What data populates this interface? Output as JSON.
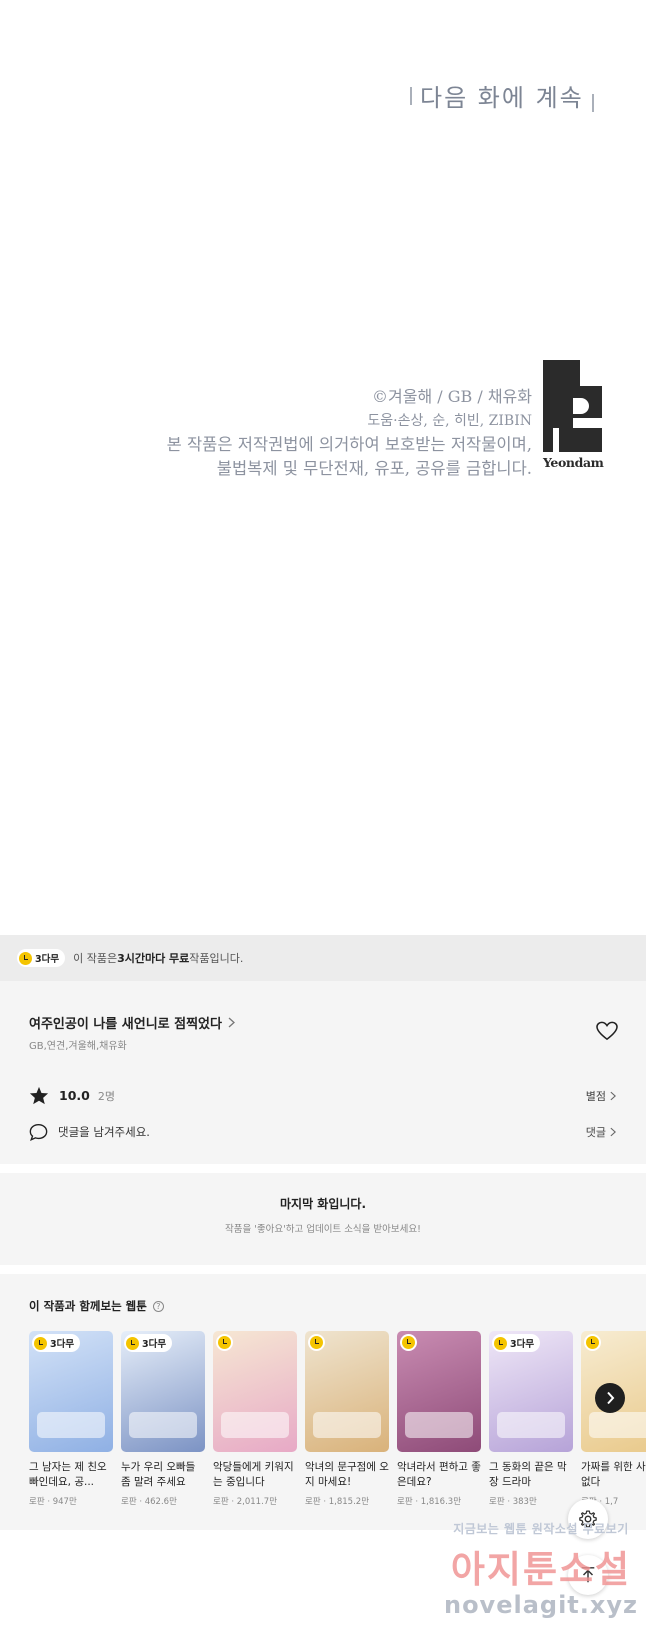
{
  "comic": {
    "next_notice": "다음 화에 계속",
    "copyright_line1": "©겨울해 / GB / 채유화",
    "copyright_line2": "도움·손상, 순, 히빈, ZIBIN",
    "copyright_line3": "본 작품은 저작권법에 의거하여 보호받는 저작물이며,",
    "copyright_line4": "불법복제 및 무단전재, 유포, 공유를 금합니다.",
    "publisher": "Yeondam"
  },
  "free_banner": {
    "badge": "3다무",
    "text_before": "이 작품은 ",
    "text_bold": "3시간마다 무료",
    "text_after": " 작품입니다."
  },
  "series": {
    "title": "여주인공이 나를 새언니로 점찍었다",
    "authors": "GB,연견,겨울해,채유화",
    "rating": "10.0",
    "rating_count": "2명",
    "rate_link": "별점",
    "comment_placeholder": "댓글을 남겨주세요.",
    "comment_link": "댓글"
  },
  "last_episode": {
    "title": "마지막 화입니다.",
    "subtitle": "작품을 '좋아요'하고 업데이트 소식을 받아보세요!"
  },
  "recommendations": {
    "title": "이 작품과 함께보는 웹툰",
    "items": [
      {
        "title": "그 남자는 제 친오빠인데요, 공...",
        "meta": "로판 · 947만",
        "badge": "3다무",
        "color": "#8fb0e4",
        "color2": "#d3e2f7"
      },
      {
        "title": "누가 우리 오빠들 좀 말려 주세요",
        "meta": "로판 · 462.6만",
        "badge": "3다무",
        "color": "#7c93c4",
        "color2": "#e6eef9"
      },
      {
        "title": "악당들에게 키워지는 중입니다",
        "meta": "로판 · 2,011.7만",
        "badge": "",
        "color": "#e7a9c6",
        "color2": "#f6e7d3"
      },
      {
        "title": "악녀의 문구점에 오지 마세요!",
        "meta": "로판 · 1,815.2만",
        "badge": "",
        "color": "#d9b27a",
        "color2": "#efe4cf"
      },
      {
        "title": "악녀라서 편하고 좋은데요?",
        "meta": "로판 · 1,816.3만",
        "badge": "",
        "color": "#8e4b78",
        "color2": "#c98cb2"
      },
      {
        "title": "그 동화의 끝은 막장 드라마",
        "meta": "로판 · 383만",
        "badge": "3다무",
        "color": "#b6a3d8",
        "color2": "#efe7f7"
      },
      {
        "title": "가짜를 위한 사랑은 없다",
        "meta": "로판 · 1,7",
        "badge": "",
        "color": "#e9c98a",
        "color2": "#f7ecd2"
      }
    ]
  },
  "watermark": {
    "line1": "지금보는 웹툰 원작소설 무료보기",
    "line2": "아지툰소설",
    "line3": "novelagit.xyz"
  },
  "icons": {
    "heart": "heart-icon",
    "star": "star-icon",
    "comment": "comment-icon",
    "chevron": "chevron-right-icon",
    "settings": "gear-icon",
    "scroll_top": "arrow-up-icon"
  }
}
